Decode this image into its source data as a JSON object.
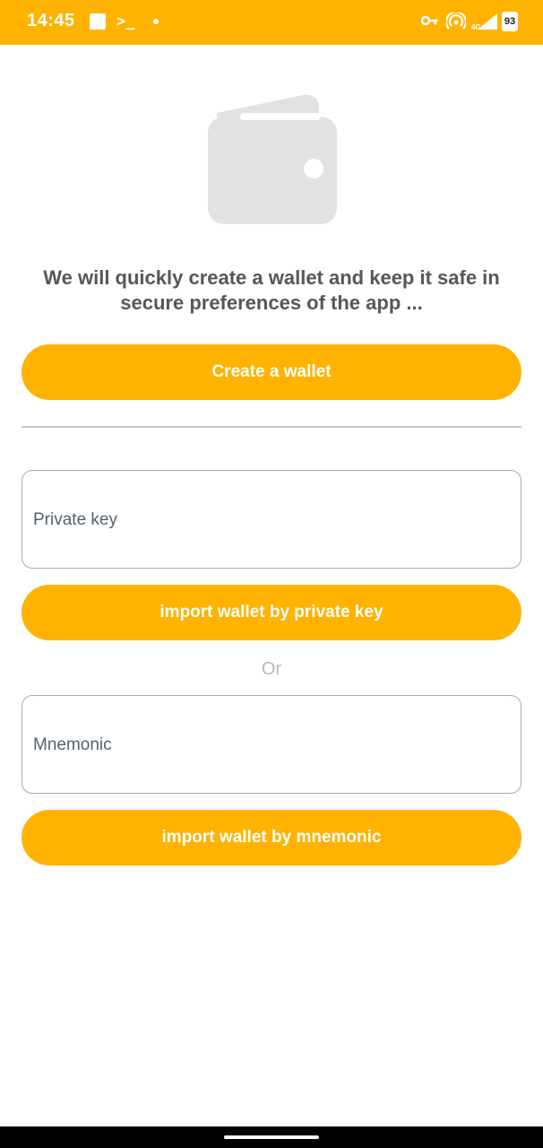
{
  "status_bar": {
    "time": "14:45",
    "battery": "93",
    "icons": [
      "notification-square-icon",
      "terminal-icon",
      "dot-icon",
      "vpn-key-icon",
      "hotspot-icon",
      "signal-4g-icon",
      "battery-icon"
    ],
    "background_color": "#FFB300"
  },
  "hero": {
    "icon": "wallet-icon",
    "message": "We will quickly create a wallet and keep it safe in secure preferences of the app ..."
  },
  "create": {
    "button_label": "Create a wallet"
  },
  "private_key_import": {
    "placeholder": "Private key",
    "value": "",
    "button_label": "import wallet by private key"
  },
  "separator_text": "Or",
  "mnemonic_import": {
    "placeholder": "Mnemonic",
    "value": "",
    "button_label": "import wallet by mnemonic"
  },
  "colors": {
    "accent": "#FFB300",
    "text_primary": "#575757",
    "placeholder": "#52626E",
    "muted": "#B7B7B7",
    "illustration": "#E2E2E4"
  }
}
